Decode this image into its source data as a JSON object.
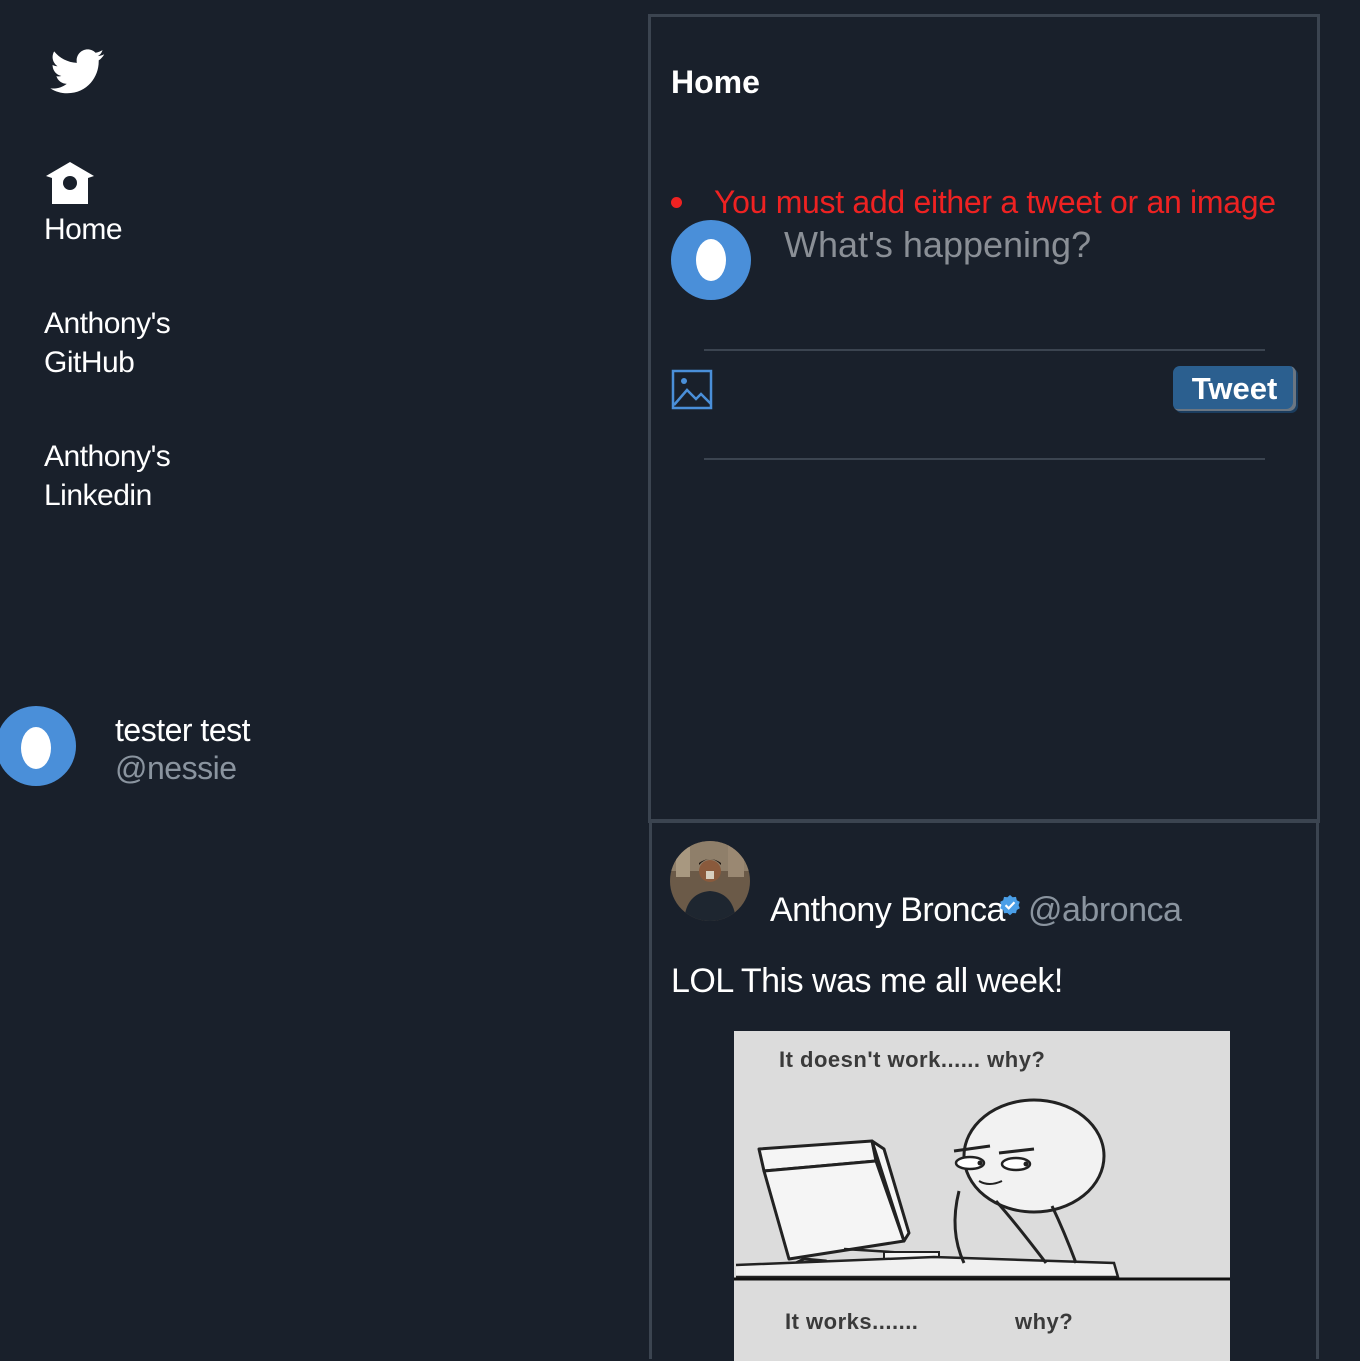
{
  "sidebar": {
    "logo_icon": "twitter-bird-icon",
    "nav": {
      "home": {
        "icon": "home-icon",
        "label": "Home"
      },
      "github": {
        "label": "Anthony's GitHub"
      },
      "linkedin": {
        "label": "Anthony's Linkedin"
      }
    },
    "profile": {
      "avatar_icon": "egg-avatar-icon",
      "name": "tester test",
      "handle": "@nessie"
    }
  },
  "main": {
    "title": "Home",
    "composer": {
      "error": "You must add either a tweet or an image",
      "placeholder": "What's happening?",
      "value": "",
      "image_icon": "image-upload-icon",
      "submit_label": "Tweet"
    },
    "feed": [
      {
        "author_name": "Anthony Bronca",
        "verified": true,
        "handle": "@abronca",
        "text": "LOL This was me all week!",
        "media": {
          "caption_top": "It doesn't work...... why?",
          "caption_bottom_left": "It works.......",
          "caption_bottom_right": "why?"
        }
      }
    ]
  },
  "colors": {
    "background": "#19202b",
    "border": "#3b4450",
    "accent": "#4a8fd9",
    "error": "#ee2222",
    "button": "#2b5f8f",
    "muted_text": "#8a949f"
  }
}
